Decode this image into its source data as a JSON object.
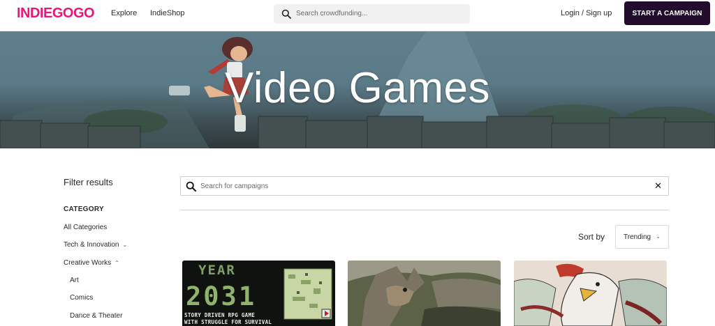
{
  "header": {
    "logo": "INDIEGOGO",
    "nav": {
      "explore": "Explore",
      "indieshop": "IndieShop"
    },
    "search_placeholder": "Search crowdfunding...",
    "login": "Login / Sign up",
    "start_campaign": "START A CAMPAIGN"
  },
  "hero": {
    "title": "Video Games"
  },
  "sidebar": {
    "filter_title": "Filter results",
    "category_heading": "CATEGORY",
    "items": [
      {
        "label": "All Categories"
      },
      {
        "label": "Tech & Innovation"
      },
      {
        "label": "Creative Works"
      },
      {
        "label": "Art"
      },
      {
        "label": "Comics"
      },
      {
        "label": "Dance & Theater"
      }
    ]
  },
  "main": {
    "search_placeholder": "Search for campaigns",
    "sort_label": "Sort by",
    "sort_value": "Trending",
    "cards": [
      {
        "year_label": "YEAR",
        "year_number": "2031",
        "line1": "STORY DRIVEN RPG GAME",
        "line2": "WITH STRUGGLE FOR SURVIVAL"
      },
      {},
      {}
    ]
  },
  "colors": {
    "brand": "#eb1478",
    "button_bg": "#230b2d"
  }
}
